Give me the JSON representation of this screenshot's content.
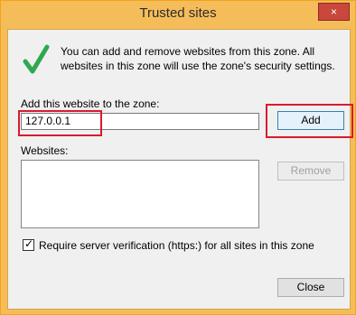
{
  "window": {
    "title": "Trusted sites",
    "close_label": "×"
  },
  "info_text": "You can add and remove websites from this zone. All websites in this zone will use the zone's security settings.",
  "add_site": {
    "label": "Add this website to the zone:",
    "value": "127.0.0.1",
    "button": "Add"
  },
  "websites": {
    "label": "Websites:",
    "items": [],
    "remove_button": "Remove"
  },
  "verification": {
    "checked": true,
    "label": "Require server verification (https:) for all sites in this zone"
  },
  "footer": {
    "close_button": "Close"
  },
  "colors": {
    "titlebar": "#f4bd5a",
    "close": "#c9473d",
    "highlight": "#d81b2f",
    "check_green": "#2fa84f"
  },
  "icons": {
    "status": "checkmark-icon"
  }
}
